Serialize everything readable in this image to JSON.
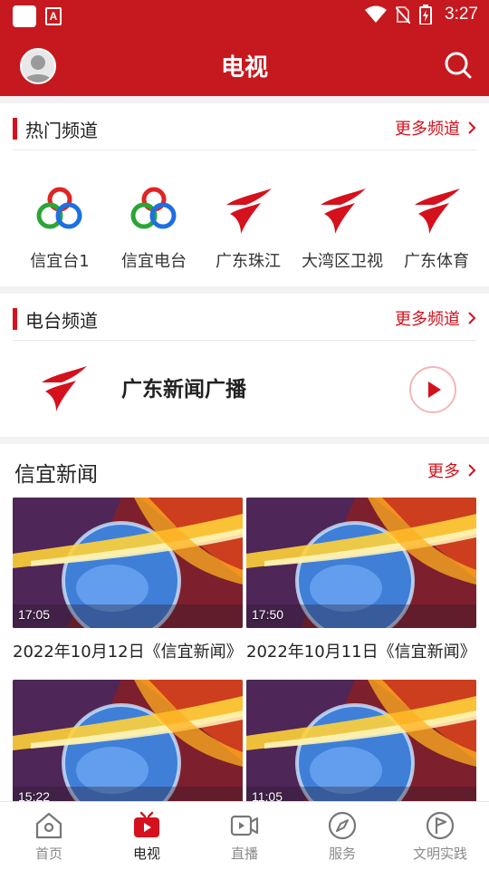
{
  "status_bar": {
    "time": "3:27"
  },
  "header": {
    "title": "电视"
  },
  "popular": {
    "title": "热门频道",
    "more": "更多频道",
    "channels": [
      {
        "label": "信宜台1",
        "logo": "xinyi-logo"
      },
      {
        "label": "信宜电台",
        "logo": "xinyi-logo"
      },
      {
        "label": "广东珠江",
        "logo": "gdtv-logo"
      },
      {
        "label": "大湾区卫视",
        "logo": "gdtv-logo"
      },
      {
        "label": "广东体育",
        "logo": "gdtv-logo"
      }
    ]
  },
  "radio": {
    "title": "电台频道",
    "more": "更多频道",
    "station": "广东新闻广播"
  },
  "news": {
    "title": "信宜新闻",
    "more": "更多",
    "items": [
      {
        "duration": "17:05",
        "caption": "2022年10月12日《信宜新闻》"
      },
      {
        "duration": "17:50",
        "caption": "2022年10月11日《信宜新闻》"
      },
      {
        "duration": "15:22",
        "caption": ""
      },
      {
        "duration": "11:05",
        "caption": ""
      }
    ]
  },
  "tabs": [
    {
      "label": "首页",
      "icon": "home-icon"
    },
    {
      "label": "电视",
      "icon": "tv-icon"
    },
    {
      "label": "直播",
      "icon": "live-video-icon"
    },
    {
      "label": "服务",
      "icon": "compass-icon"
    },
    {
      "label": "文明实践",
      "icon": "flag-circle-icon"
    }
  ],
  "colors": {
    "brand_red": "#c6191f",
    "accent_red": "#d4111c"
  }
}
